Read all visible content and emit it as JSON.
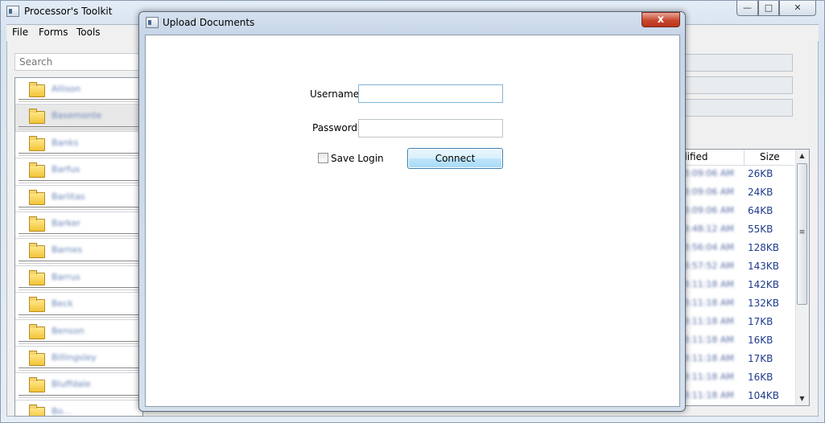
{
  "main_window": {
    "title": "Processor's Toolkit",
    "controls": {
      "minimize": "—",
      "maximize": "□",
      "close": "✕"
    }
  },
  "menu": [
    "File",
    "Forms",
    "Tools"
  ],
  "search": {
    "placeholder": "Search"
  },
  "folders": [
    {
      "label": "Allison"
    },
    {
      "label": "Basemonte"
    },
    {
      "label": "Banks"
    },
    {
      "label": "Barfus"
    },
    {
      "label": "Barlitas"
    },
    {
      "label": "Barker"
    },
    {
      "label": "Barnes"
    },
    {
      "label": "Barrus"
    },
    {
      "label": "Beck"
    },
    {
      "label": "Benson"
    },
    {
      "label": "Billingsley"
    },
    {
      "label": "Bluffdale"
    },
    {
      "label": "Bo..."
    }
  ],
  "file_grid": {
    "columns": {
      "modified": "dified",
      "size": "Size"
    },
    "rows": [
      {
        "modified": "3:09:06 AM",
        "size": "26KB"
      },
      {
        "modified": "3:09:06 AM",
        "size": "24KB"
      },
      {
        "modified": "3:09:06 AM",
        "size": "64KB"
      },
      {
        "modified": "3:48:12 AM",
        "size": "55KB"
      },
      {
        "modified": "3:56:04 AM",
        "size": "128KB"
      },
      {
        "modified": "3:57:52 AM",
        "size": "143KB"
      },
      {
        "modified": "3:11:18 AM",
        "size": "142KB"
      },
      {
        "modified": "3:11:18 AM",
        "size": "132KB"
      },
      {
        "modified": "3:11:18 AM",
        "size": "17KB"
      },
      {
        "modified": "3:11:18 AM",
        "size": "16KB"
      },
      {
        "modified": "3:11:18 AM",
        "size": "17KB"
      },
      {
        "modified": "3:11:18 AM",
        "size": "16KB"
      },
      {
        "modified": "3:11:18 AM",
        "size": "104KB"
      }
    ]
  },
  "scrollbar": {
    "up": "▲",
    "grip": "≡",
    "down": "▼"
  },
  "dialog": {
    "title": "Upload Documents",
    "close": "x",
    "username_label": "Username",
    "username_value": "",
    "password_label": "Password",
    "password_value": "",
    "save_login_label": "Save Login",
    "save_login_checked": false,
    "connect_label": "Connect"
  }
}
